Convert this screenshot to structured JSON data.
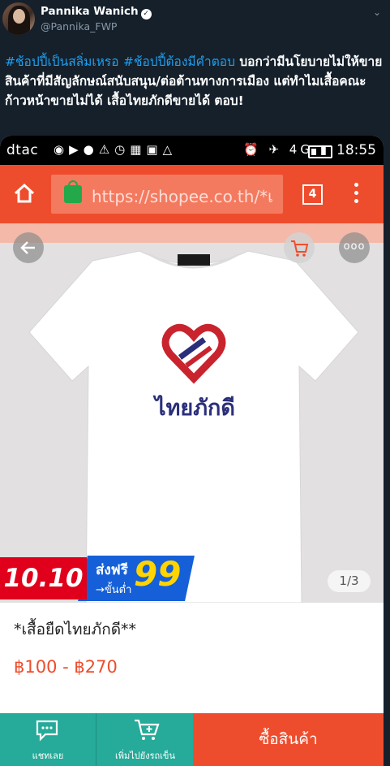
{
  "tweet": {
    "display_name": "Pannika Wanich",
    "handle": "@Pannika_FWP",
    "hashtag1": "#ช้อปปี้เป็นสลิ่มเหรอ",
    "hashtag2": "#ช้อปปี้ต้องมีคำตอบ",
    "body": " บอกว่ามีนโยบายไม่ให้ขายสินค้าที่มีสัญลักษณ์สนับสนุน/ต่อต้านทางการเมือง แต่ทำไมเสื้อคณะก้าวหน้าขายไม่ได้ เสื้อไทยภักดีขายได้ ตอบ!"
  },
  "phone_status": {
    "carrier": "dtac",
    "network": "4G",
    "time": "18:55"
  },
  "browser": {
    "url": "https://shopee.co.th/*เ",
    "tab_count": "4"
  },
  "product": {
    "brand_text": "ไทยภักดี",
    "promo_date": "10.10",
    "promo_free_shipping": "ส่งฟรี",
    "promo_min_label": "→ขั้นต่ำ",
    "promo_min_value": "99",
    "image_counter": "1/3",
    "title": "*เสื้อยืดไทยภักดี**",
    "price": "฿100 - ฿270"
  },
  "actions": {
    "chat_label": "แชทเลย",
    "add_cart_label": "เพิ่มไปยังรถเข็น",
    "buy_label": "ซื้อสินค้า"
  },
  "colors": {
    "shopee_orange": "#ee4d2d",
    "teal": "#26aa99",
    "twitter_bg": "#15202b",
    "hashtag_blue": "#1da1f2"
  }
}
